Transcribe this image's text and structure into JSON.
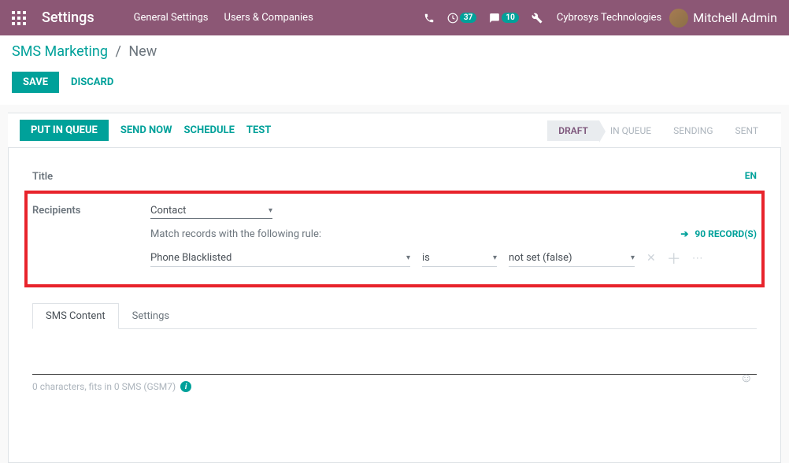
{
  "navbar": {
    "title": "Settings",
    "links": [
      "General Settings",
      "Users & Companies"
    ],
    "activities_count": "37",
    "messages_count": "10",
    "company": "Cybrosys Technologies",
    "user": "Mitchell Admin"
  },
  "breadcrumb": {
    "root": "SMS Marketing",
    "current": "New"
  },
  "actions": {
    "save": "SAVE",
    "discard": "DISCARD"
  },
  "toolbar": {
    "put_in_queue": "PUT IN QUEUE",
    "send_now": "SEND NOW",
    "schedule": "SCHEDULE",
    "test": "TEST"
  },
  "status": {
    "steps": [
      "DRAFT",
      "IN QUEUE",
      "SENDING",
      "SENT"
    ]
  },
  "form": {
    "title_label": "Title",
    "lang": "EN",
    "recipients_label": "Recipients",
    "recipients_value": "Contact",
    "match_text": "Match records with the following rule:",
    "record_count_label": "90 RECORD(S)",
    "rule": {
      "field": "Phone Blacklisted",
      "operator": "is",
      "value": "not set (false)"
    }
  },
  "tabs": {
    "sms_content": "SMS Content",
    "settings": "Settings"
  },
  "sms": {
    "counter": "0 characters, fits in 0 SMS (GSM7)"
  }
}
